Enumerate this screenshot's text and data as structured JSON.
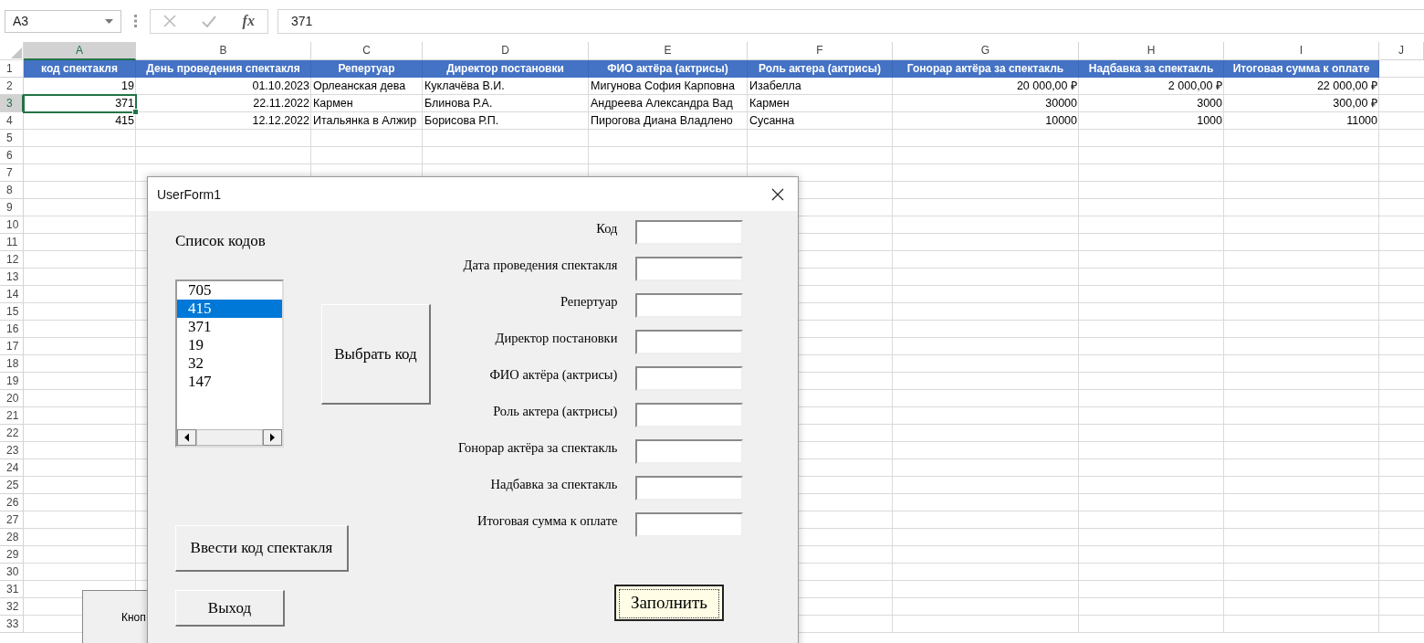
{
  "formula_bar": {
    "name_box": "A3",
    "function_label": "fx",
    "formula": "371"
  },
  "sheet": {
    "columns": [
      {
        "letter": "A",
        "selected": true,
        "kind": "number"
      },
      {
        "letter": "B",
        "selected": false,
        "kind": "number"
      },
      {
        "letter": "C",
        "selected": false,
        "kind": "text"
      },
      {
        "letter": "D",
        "selected": false,
        "kind": "text"
      },
      {
        "letter": "E",
        "selected": false,
        "kind": "text"
      },
      {
        "letter": "F",
        "selected": false,
        "kind": "text"
      },
      {
        "letter": "G",
        "selected": false,
        "kind": "number"
      },
      {
        "letter": "H",
        "selected": false,
        "kind": "number"
      },
      {
        "letter": "I",
        "selected": false,
        "kind": "number"
      },
      {
        "letter": "J",
        "selected": false
      }
    ],
    "rows": [
      {
        "number": "1",
        "selected": false,
        "kind": "header",
        "cells": [
          "код спектакля",
          "День проведения спектакля",
          "Репертуар",
          "Директор постановки",
          "ФИО актёра (актрисы)",
          "Роль актера (актрисы)",
          "Гонорар актёра за спектакль",
          "Надбавка за спектакль",
          "Итоговая сумма к оплате"
        ]
      },
      {
        "number": "2",
        "selected": false,
        "kind": "data",
        "cells": [
          "19",
          "01.10.2023",
          "Орлеанская дева",
          "Куклачёва В.И.",
          "Мигунова София Карповна",
          "Изабелла",
          "20 000,00 ₽",
          "2 000,00 ₽",
          "22 000,00 ₽"
        ]
      },
      {
        "number": "3",
        "selected": true,
        "kind": "data",
        "cells": [
          "371",
          "22.11.2022",
          "Кармен",
          "Блинова Р.А.",
          "Андреева Александра Вад",
          "Кармен",
          "30000",
          "3000",
          "300,00 ₽"
        ]
      },
      {
        "number": "4",
        "selected": false,
        "kind": "data",
        "cells": [
          "415",
          "12.12.2022",
          "Итальянка в Алжир",
          "Борисова Р.П.",
          "Пирогова Диана Владлено",
          "Сусанна",
          "10000",
          "1000",
          "11000"
        ]
      },
      {
        "number": "5",
        "selected": false
      },
      {
        "number": "6",
        "selected": false
      },
      {
        "number": "7",
        "selected": false
      },
      {
        "number": "8",
        "selected": false
      },
      {
        "number": "9",
        "selected": false
      },
      {
        "number": "10",
        "selected": false
      },
      {
        "number": "11",
        "selected": false
      },
      {
        "number": "12",
        "selected": false
      },
      {
        "number": "13",
        "selected": false
      },
      {
        "number": "14",
        "selected": false
      },
      {
        "number": "15",
        "selected": false
      },
      {
        "number": "16",
        "selected": false
      },
      {
        "number": "17",
        "selected": false
      },
      {
        "number": "18",
        "selected": false
      },
      {
        "number": "19",
        "selected": false
      },
      {
        "number": "20",
        "selected": false
      },
      {
        "number": "21",
        "selected": false
      },
      {
        "number": "22",
        "selected": false
      },
      {
        "number": "23",
        "selected": false
      },
      {
        "number": "24",
        "selected": false
      },
      {
        "number": "25",
        "selected": false
      },
      {
        "number": "26",
        "selected": false
      },
      {
        "number": "27",
        "selected": false
      },
      {
        "number": "28",
        "selected": false
      },
      {
        "number": "29",
        "selected": false
      },
      {
        "number": "30",
        "selected": false
      },
      {
        "number": "31",
        "selected": false
      },
      {
        "number": "32",
        "selected": false
      },
      {
        "number": "33",
        "selected": false
      }
    ],
    "sheet_button": {
      "label": "Кноп"
    }
  },
  "dialog": {
    "title": "UserForm1",
    "list_label": "Список кодов",
    "list_items": [
      {
        "label": "705",
        "selected": false
      },
      {
        "label": "415",
        "selected": true
      },
      {
        "label": "371",
        "selected": false
      },
      {
        "label": "19",
        "selected": false
      },
      {
        "label": "32",
        "selected": false
      },
      {
        "label": "147",
        "selected": false
      }
    ],
    "select_button": "Выбрать код",
    "enter_button": "Ввести код спектакля",
    "exit_button": "Выход",
    "fields": [
      {
        "label": "Код"
      },
      {
        "label": "Дата проведения спектакля"
      },
      {
        "label": "Репертуар"
      },
      {
        "label": "Директор постановки"
      },
      {
        "label": "ФИО актёра (актрисы)"
      },
      {
        "label": "Роль актера (актрисы)"
      },
      {
        "label": "Гонорар актёра за спектакль"
      },
      {
        "label": "Надбавка за спектакль"
      },
      {
        "label": "Итоговая сумма к оплате"
      }
    ],
    "fill_button": {
      "label": "Заполнить",
      "focused": true
    }
  }
}
